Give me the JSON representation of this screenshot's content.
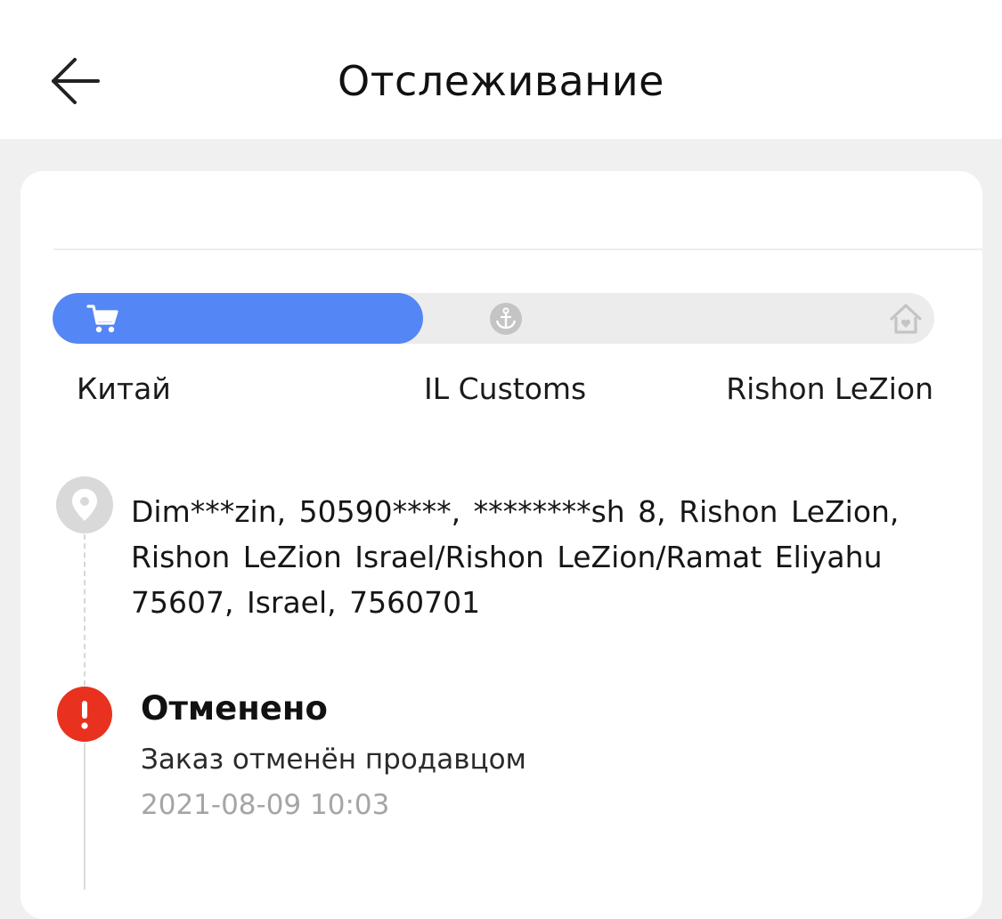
{
  "header": {
    "title": "Отслеживание",
    "back_icon": "arrow-left-icon"
  },
  "tracking": {
    "progress_fraction": 0.42,
    "colors": {
      "active": "#5487f5",
      "track": "#ececec",
      "inactive_icon": "#c4c4c4",
      "alert": "#e8321f"
    },
    "stages": [
      {
        "label": "Китай",
        "icon": "cart-icon",
        "active": true
      },
      {
        "label": "IL Customs",
        "icon": "anchor-icon",
        "active": false
      },
      {
        "label": "Rishon LeZion",
        "icon": "home-icon",
        "active": false
      }
    ]
  },
  "address": {
    "icon": "location-pin-icon",
    "text": "Dim***zin,  50590****,  ********sh 8,  Rishon LeZion,  Rishon LeZion Israel/Rishon LeZion/Ramat Eliyahu 75607,  Israel,  7560701"
  },
  "event": {
    "icon": "alert-icon",
    "title": "Отменено",
    "description": "Заказ отменён продавцом",
    "timestamp": "2021-08-09 10:03"
  }
}
